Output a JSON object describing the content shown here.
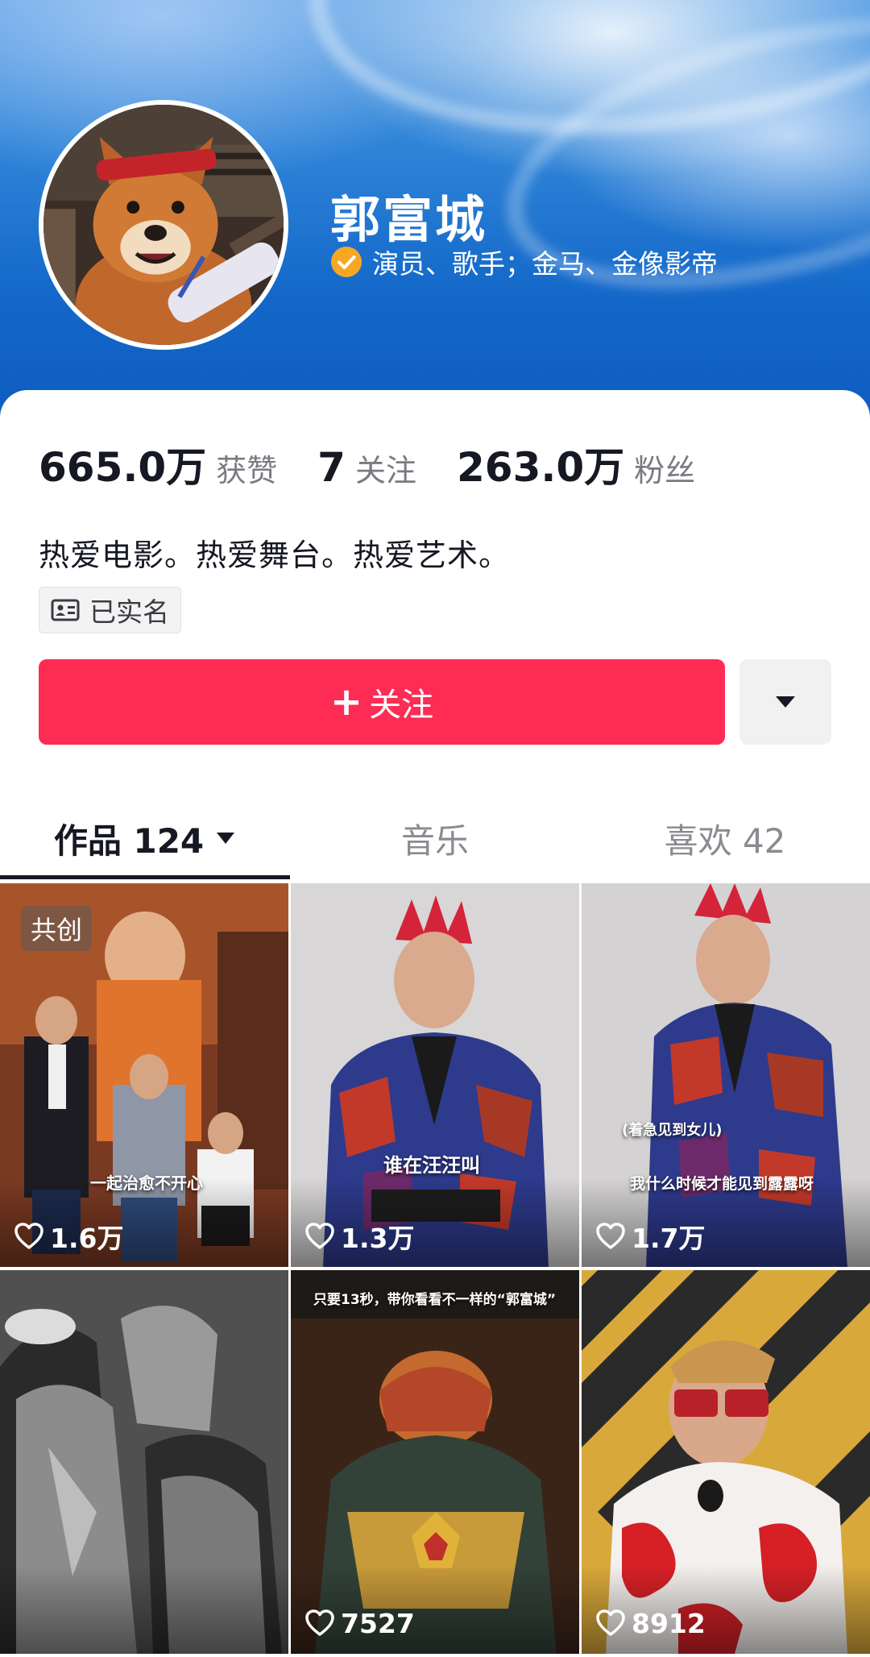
{
  "profile": {
    "name": "郭富城",
    "verified_text": "演员、歌手；金马、金像影帝",
    "bio": "热爱电影。热爱舞台。热爱艺术。",
    "real_name_badge": "已实名"
  },
  "stats": [
    {
      "value": "665.0万",
      "label": "获赞"
    },
    {
      "value": "7",
      "label": "关注"
    },
    {
      "value": "263.0万",
      "label": "粉丝"
    }
  ],
  "actions": {
    "follow_label": "关注",
    "follow_plus": "+"
  },
  "tabs": [
    {
      "label": "作品 124",
      "active": true
    },
    {
      "label": "音乐",
      "active": false
    },
    {
      "label": "喜欢 42",
      "active": false
    }
  ],
  "videos": [
    {
      "likes": "1.6万",
      "badge": "共创",
      "caption": "一起治愈不开心"
    },
    {
      "likes": "1.3万",
      "caption": "谁在汪汪叫"
    },
    {
      "likes": "1.7万",
      "caption": "我什么时候才能见到露露呀",
      "caption2": "(着急见到女儿)"
    },
    {
      "likes": ""
    },
    {
      "likes": "7527",
      "caption": "只要13秒，带你看看不一样的“郭富城”"
    },
    {
      "likes": "8912"
    }
  ],
  "colors": {
    "accent": "#fe2c55",
    "verified": "#f7a823",
    "banner": "#1468c9"
  },
  "icons": {
    "verified": "verified-check-icon",
    "real_name": "id-card-icon",
    "more": "caret-down-icon",
    "likes": "heart-outline-icon"
  }
}
